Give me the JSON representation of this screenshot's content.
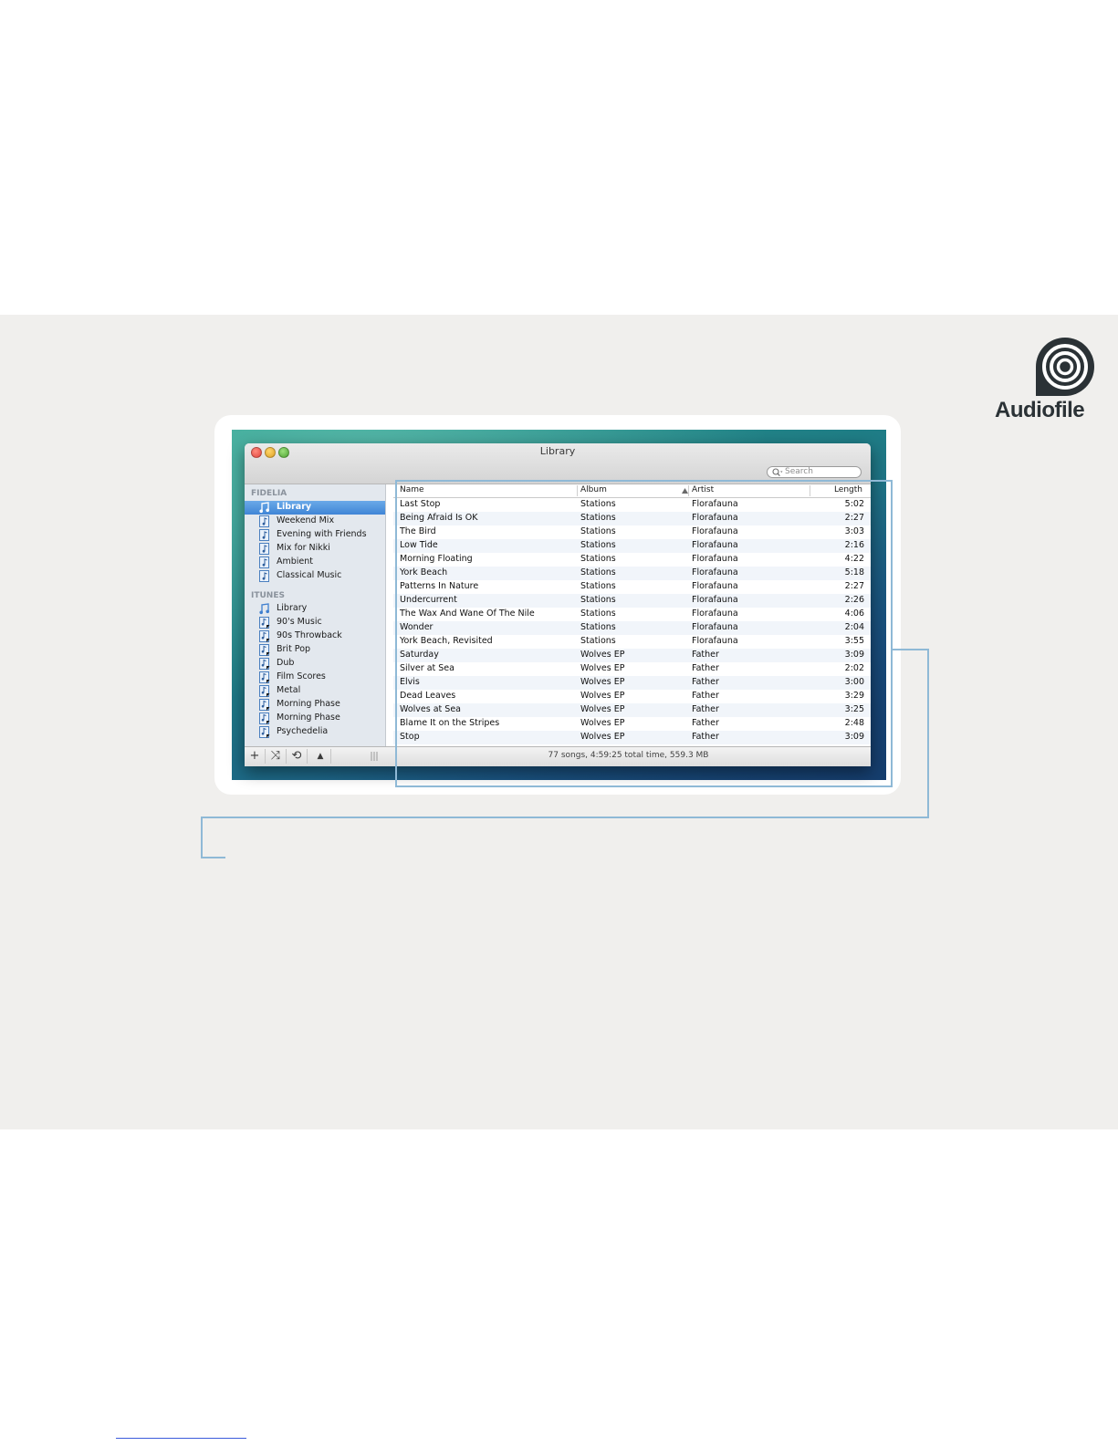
{
  "brand": {
    "name": "Audiofile",
    "color": "#2b3236",
    "icon": "concentric-rings-logo-icon"
  },
  "window": {
    "title": "Library",
    "search_placeholder": "Search"
  },
  "sidebar": {
    "sections": [
      {
        "heading": "FIDELIA",
        "items": [
          {
            "label": "Library",
            "selected": true,
            "icon": "library-note-icon"
          },
          {
            "label": "Weekend Mix",
            "icon": "playlist-icon"
          },
          {
            "label": "Evening with Friends",
            "icon": "playlist-icon"
          },
          {
            "label": "Mix for Nikki",
            "icon": "playlist-icon"
          },
          {
            "label": "Ambient",
            "icon": "playlist-icon"
          },
          {
            "label": "Classical Music",
            "icon": "playlist-icon"
          }
        ]
      },
      {
        "heading": "ITUNES",
        "items": [
          {
            "label": "Library",
            "icon": "library-note-icon"
          },
          {
            "label": "90's Music",
            "icon": "itunes-playlist-icon"
          },
          {
            "label": "90s Throwback",
            "icon": "itunes-playlist-icon"
          },
          {
            "label": "Brit Pop",
            "icon": "itunes-playlist-icon"
          },
          {
            "label": "Dub",
            "icon": "itunes-playlist-icon"
          },
          {
            "label": "Film Scores",
            "icon": "itunes-playlist-icon"
          },
          {
            "label": "Metal",
            "icon": "itunes-playlist-icon"
          },
          {
            "label": "Morning Phase",
            "icon": "itunes-playlist-icon"
          },
          {
            "label": "Morning Phase",
            "icon": "itunes-playlist-icon"
          },
          {
            "label": "Psychedelia",
            "icon": "itunes-playlist-icon"
          }
        ]
      }
    ]
  },
  "table": {
    "columns": [
      "Name",
      "Album",
      "Artist",
      "Length"
    ],
    "sorted_by": "Album",
    "rows": [
      [
        "Last Stop",
        "Stations",
        "Florafauna",
        "5:02"
      ],
      [
        "Being Afraid Is OK",
        "Stations",
        "Florafauna",
        "2:27"
      ],
      [
        "The Bird",
        "Stations",
        "Florafauna",
        "3:03"
      ],
      [
        "Low Tide",
        "Stations",
        "Florafauna",
        "2:16"
      ],
      [
        "Morning Floating",
        "Stations",
        "Florafauna",
        "4:22"
      ],
      [
        "York Beach",
        "Stations",
        "Florafauna",
        "5:18"
      ],
      [
        "Patterns In Nature",
        "Stations",
        "Florafauna",
        "2:27"
      ],
      [
        "Undercurrent",
        "Stations",
        "Florafauna",
        "2:26"
      ],
      [
        "The Wax And Wane Of The Nile",
        "Stations",
        "Florafauna",
        "4:06"
      ],
      [
        "Wonder",
        "Stations",
        "Florafauna",
        "2:04"
      ],
      [
        "York Beach, Revisited",
        "Stations",
        "Florafauna",
        "3:55"
      ],
      [
        "Saturday",
        "Wolves EP",
        "Father",
        "3:09"
      ],
      [
        "Silver at Sea",
        "Wolves EP",
        "Father",
        "2:02"
      ],
      [
        "Elvis",
        "Wolves EP",
        "Father",
        "3:00"
      ],
      [
        "Dead Leaves",
        "Wolves EP",
        "Father",
        "3:29"
      ],
      [
        "Wolves at Sea",
        "Wolves EP",
        "Father",
        "3:25"
      ],
      [
        "Blame It on the Stripes",
        "Wolves EP",
        "Father",
        "2:48"
      ],
      [
        "Stop",
        "Wolves EP",
        "Father",
        "3:09"
      ]
    ]
  },
  "bottombar": {
    "buttons": [
      {
        "glyph": "+",
        "icon": "add-icon"
      },
      {
        "glyph": "⤨",
        "icon": "shuffle-icon"
      },
      {
        "glyph": "⟲",
        "icon": "repeat-icon"
      },
      {
        "glyph": "▲",
        "icon": "eject-icon"
      }
    ],
    "status": "77 songs, 4:59:25 total time, 559.3 MB"
  },
  "colors": {
    "selection": "#3f85d6",
    "callout": "#8fb9d6",
    "band": "#f0efed"
  }
}
